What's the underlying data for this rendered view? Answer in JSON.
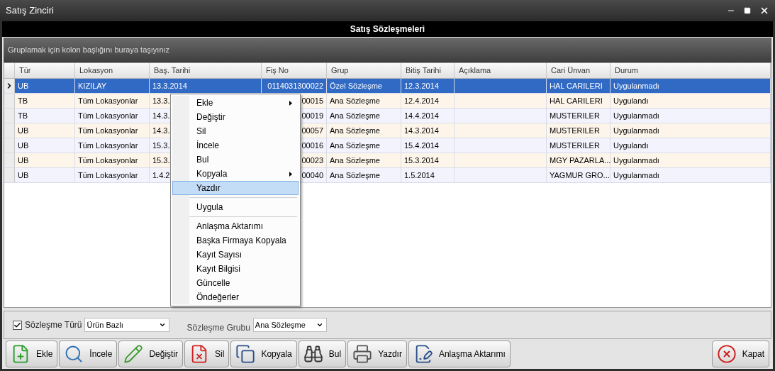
{
  "window": {
    "title": "Satış Zinciri"
  },
  "header": {
    "title": "Satış Sözleşmeleri"
  },
  "group_panel": {
    "hint": "Gruplamak için kolon başlığını buraya taşıyınız"
  },
  "grid": {
    "columns": [
      "Tür",
      "Lokasyon",
      "Baş. Tarihi",
      "Fiş No",
      "Grup",
      "Bitiş Tarihi",
      "Açıklama",
      "Cari Ünvan",
      "Durum"
    ],
    "rows": [
      {
        "selected": true,
        "cells": [
          "UB",
          "KIZILAY",
          "13.3.2014",
          "0114031300022",
          "Özel Sözleşme",
          "12.3.2014",
          "",
          "HAL CARILERI",
          "Uygulanmadı"
        ]
      },
      {
        "selected": false,
        "cells": [
          "TB",
          "Tüm Lokasyonlar",
          "13.3.",
          "00015",
          "Ana Sözleşme",
          "12.4.2014",
          "",
          "HAL CARILERI",
          "Uygulandı"
        ]
      },
      {
        "selected": false,
        "cells": [
          "TB",
          "Tüm Lokasyonlar",
          "14.3.",
          "00019",
          "Ana Sözleşme",
          "14.4.2014",
          "",
          "MUSTERILER",
          "Uygulanmadı"
        ]
      },
      {
        "selected": false,
        "cells": [
          "UB",
          "Tüm Lokasyonlar",
          "14.3.",
          "00057",
          "Ana Sözleşme",
          "14.3.2014",
          "",
          "MUSTERILER",
          "Uygulanmadı"
        ]
      },
      {
        "selected": false,
        "cells": [
          "UB",
          "Tüm Lokasyonlar",
          "15.3.",
          "00016",
          "Ana Sözleşme",
          "15.4.2014",
          "",
          "MUSTERILER",
          "Uygulandı"
        ]
      },
      {
        "selected": false,
        "cells": [
          "UB",
          "Tüm Lokasyonlar",
          "15.3.",
          "00023",
          "Ana Sözleşme",
          "15.3.2014",
          "",
          "MGY PAZARLA...",
          "Uygulanmadı"
        ]
      },
      {
        "selected": false,
        "cells": [
          "UB",
          "Tüm Lokasyonlar",
          "1.4.2",
          "00040",
          "Ana Sözleşme",
          "1.5.2014",
          "",
          "YAGMUR GRO...",
          "Uygulanmadı"
        ]
      }
    ]
  },
  "context_menu": {
    "items": [
      {
        "kind": "item",
        "label": "Ekle",
        "submenu": true,
        "selected": false
      },
      {
        "kind": "item",
        "label": "Değiştir",
        "submenu": false,
        "selected": false
      },
      {
        "kind": "item",
        "label": "Sil",
        "submenu": false,
        "selected": false
      },
      {
        "kind": "item",
        "label": "İncele",
        "submenu": false,
        "selected": false
      },
      {
        "kind": "item",
        "label": "Bul",
        "submenu": false,
        "selected": false
      },
      {
        "kind": "item",
        "label": "Kopyala",
        "submenu": true,
        "selected": false
      },
      {
        "kind": "item",
        "label": "Yazdır",
        "submenu": false,
        "selected": true
      },
      {
        "kind": "separator"
      },
      {
        "kind": "item",
        "label": "Uygula",
        "submenu": false,
        "selected": false
      },
      {
        "kind": "separator"
      },
      {
        "kind": "item",
        "label": "Anlaşma Aktarımı",
        "submenu": false,
        "selected": false
      },
      {
        "kind": "item",
        "label": "Başka Firmaya Kopyala",
        "submenu": false,
        "selected": false
      },
      {
        "kind": "item",
        "label": "Kayıt Sayısı",
        "submenu": false,
        "selected": false
      },
      {
        "kind": "item",
        "label": "Kayıt Bilgisi",
        "submenu": false,
        "selected": false
      },
      {
        "kind": "item",
        "label": "Güncelle",
        "submenu": false,
        "selected": false
      },
      {
        "kind": "item",
        "label": "Öndeğerler",
        "submenu": false,
        "selected": false
      }
    ]
  },
  "filters": {
    "contract_type": {
      "label": "Sözleşme Türü",
      "checked": true,
      "value": "Ürün Bazlı"
    },
    "contract_group": {
      "label": "Sözleşme Grubu",
      "value": "Ana Sözleşme"
    }
  },
  "toolbar": {
    "buttons": [
      {
        "kind": "add",
        "label": "Ekle"
      },
      {
        "kind": "inspect",
        "label": "İncele"
      },
      {
        "kind": "edit",
        "label": "Değiştir"
      },
      {
        "kind": "delete",
        "label": "Sil"
      },
      {
        "kind": "copy",
        "label": "Kopyala"
      },
      {
        "kind": "find",
        "label": "Bul"
      },
      {
        "kind": "print",
        "label": "Yazdır"
      },
      {
        "kind": "transfer",
        "label": "Anlaşma Aktarımı"
      }
    ],
    "close_button": {
      "kind": "close",
      "label": "Kapat"
    }
  }
}
